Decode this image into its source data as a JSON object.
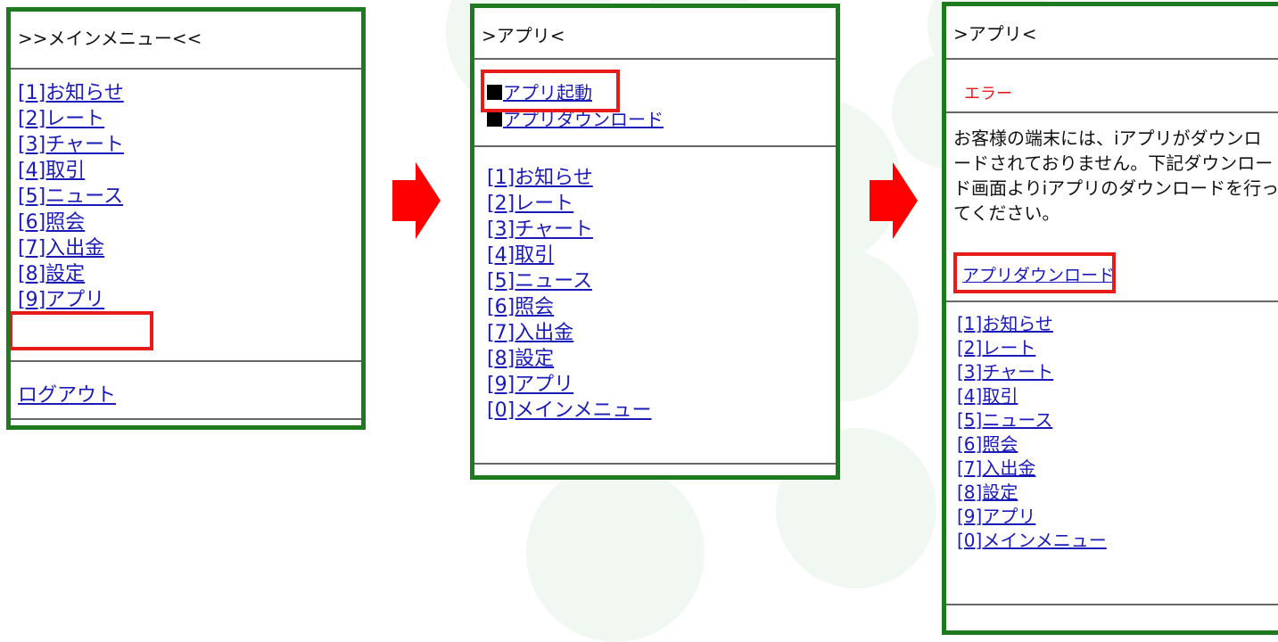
{
  "colors": {
    "panel_border": "#1e7a1e",
    "highlight": "#e81b1b",
    "link": "#1a1ab8",
    "arrow": "#ff0000",
    "error": "#e81b1b"
  },
  "panel1": {
    "title": ">>メインメニュー<<",
    "menu": [
      "[1]お知らせ",
      "[2]レート",
      "[3]チャート",
      "[4]取引",
      "[5]ニュース",
      "[6]照会",
      "[7]入出金",
      "[8]設定",
      "[9]アプリ"
    ],
    "logout": "ログアウト"
  },
  "panel2": {
    "title": ">アプリ<",
    "app_launch": "アプリ起動",
    "app_download": "アプリダウンロード",
    "menu": [
      "[1]お知らせ",
      "[2]レート",
      "[3]チャート",
      "[4]取引",
      "[5]ニュース",
      "[6]照会",
      "[7]入出金",
      "[8]設定",
      "[9]アプリ",
      "[0]メインメニュー"
    ]
  },
  "panel3": {
    "title": ">アプリ<",
    "error": "エラー",
    "message_lines": [
      "お客様の端末には、iアプリがダウンロ",
      "ードされておりません。下記ダウンロー",
      "ド画面よりiアプリのダウンロードを行っ",
      "てください。"
    ],
    "download_link": "アプリダウンロード",
    "menu": [
      "[1]お知らせ",
      "[2]レート",
      "[3]チャート",
      "[4]取引",
      "[5]ニュース",
      "[6]照会",
      "[7]入出金",
      "[8]設定",
      "[9]アプリ",
      "[0]メインメニュー"
    ]
  }
}
